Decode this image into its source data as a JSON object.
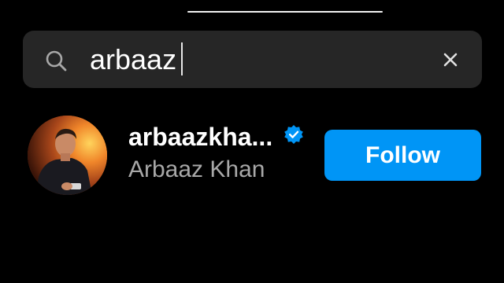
{
  "search": {
    "query": "arbaaz",
    "icon": "search-icon",
    "clear_icon": "close-icon"
  },
  "results": [
    {
      "username": "arbaazkha...",
      "full_name": "Arbaaz Khan",
      "verified": true,
      "avatar_icon": "profile-photo",
      "follow_label": "Follow"
    }
  ],
  "colors": {
    "background": "#000000",
    "search_bg": "#262626",
    "follow_button": "#0095f6",
    "verified_badge": "#0095f6",
    "secondary_text": "#a8a8a8"
  }
}
